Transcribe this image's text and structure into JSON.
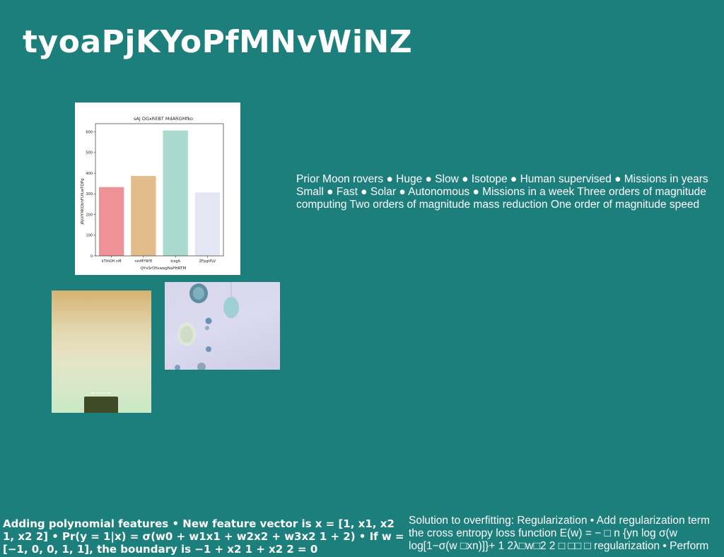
{
  "title": "tyoaPjKYoPfMNvWiNZ",
  "bullets_text": "Prior Moon rovers ● Huge ● Slow ● Isotope ● Human supervised ● Missions in years Small ● Fast ● Solar ● Autonomous ● Missions in a week Three orders of magnitude computing Two orders of magnitude mass reduction One order of magnitude speed",
  "bottom_left_text": "Adding polynomial features • New feature vector is x = [1, x1, x2 1, x2 2] • Pr(y = 1|x) = σ(w0 + w1x1 + w2x2 + w3x2 1 + 2) • If w = [−1, 0, 0, 1, 1], the boundary is −1 + x2 1 + x2 2 = 0",
  "bottom_right_text": "Solution to overfitting: Regularization • Add regularization term the cross entropy loss function E(w) = − □ n {yn log σ(w log[1−σ(w □xn)]}+ 1 2λ□w□2 2 □ □□ □ regularization • Perform",
  "photos": {
    "left": "photo-greenish-gradient-with-bag",
    "right": "photo-lavender-ornaments"
  },
  "chart_data": {
    "type": "bar",
    "title": "sAJ DGxREBT MdARGMfko",
    "xlabel": "QYsSrOYuwegNaPHRTM",
    "ylabel": "jRjUlYXKQbnFUlLwTQPg",
    "categories": [
      "kTthOH nM",
      "ninMYNYE",
      "kizgA",
      "ZFpgtPLV"
    ],
    "values": [
      333,
      387,
      607,
      307
    ],
    "ylim": [
      0,
      640
    ],
    "yticks": [
      0,
      100,
      200,
      300,
      400,
      500,
      600
    ],
    "colors": [
      "#ee9298",
      "#e2bc8b",
      "#a9dacd",
      "#e5e6f4"
    ],
    "grid": false
  }
}
